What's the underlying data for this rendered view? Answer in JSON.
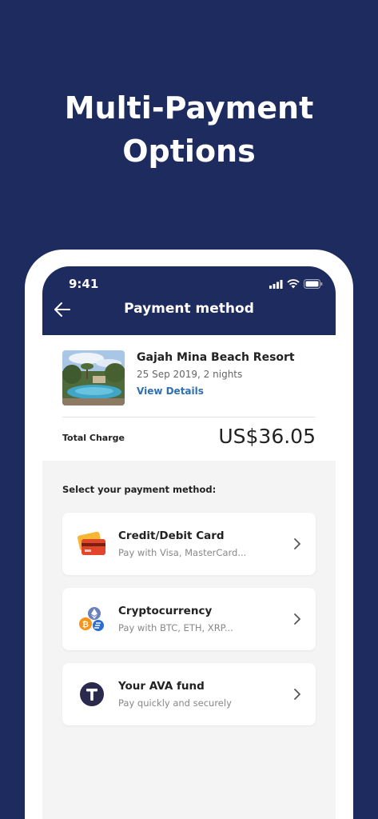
{
  "headline": {
    "line1": "Multi-Payment",
    "line2": "Options"
  },
  "status_bar": {
    "time": "9:41"
  },
  "nav": {
    "title": "Payment method"
  },
  "booking": {
    "hotel_name": "Gajah Mina Beach Resort",
    "dates": "25 Sep 2019, 2 nights",
    "view_details": "View Details",
    "total_label": "Total Charge",
    "total_amount": "US$36.05"
  },
  "payment": {
    "select_label": "Select your payment method:",
    "options": [
      {
        "title": "Credit/Debit Card",
        "subtitle": "Pay with Visa, MasterCard...",
        "icon": "credit-card-icon"
      },
      {
        "title": "Cryptocurrency",
        "subtitle": "Pay with BTC, ETH, XRP...",
        "icon": "crypto-coins-icon"
      },
      {
        "title": "Your AVA fund",
        "subtitle": "Pay quickly and securely",
        "icon": "ava-token-icon"
      }
    ]
  },
  "colors": {
    "brand_navy": "#1e2b5e",
    "link_blue": "#2f6fb3",
    "card_orange": "#f59a23",
    "card_red": "#e1462b"
  }
}
